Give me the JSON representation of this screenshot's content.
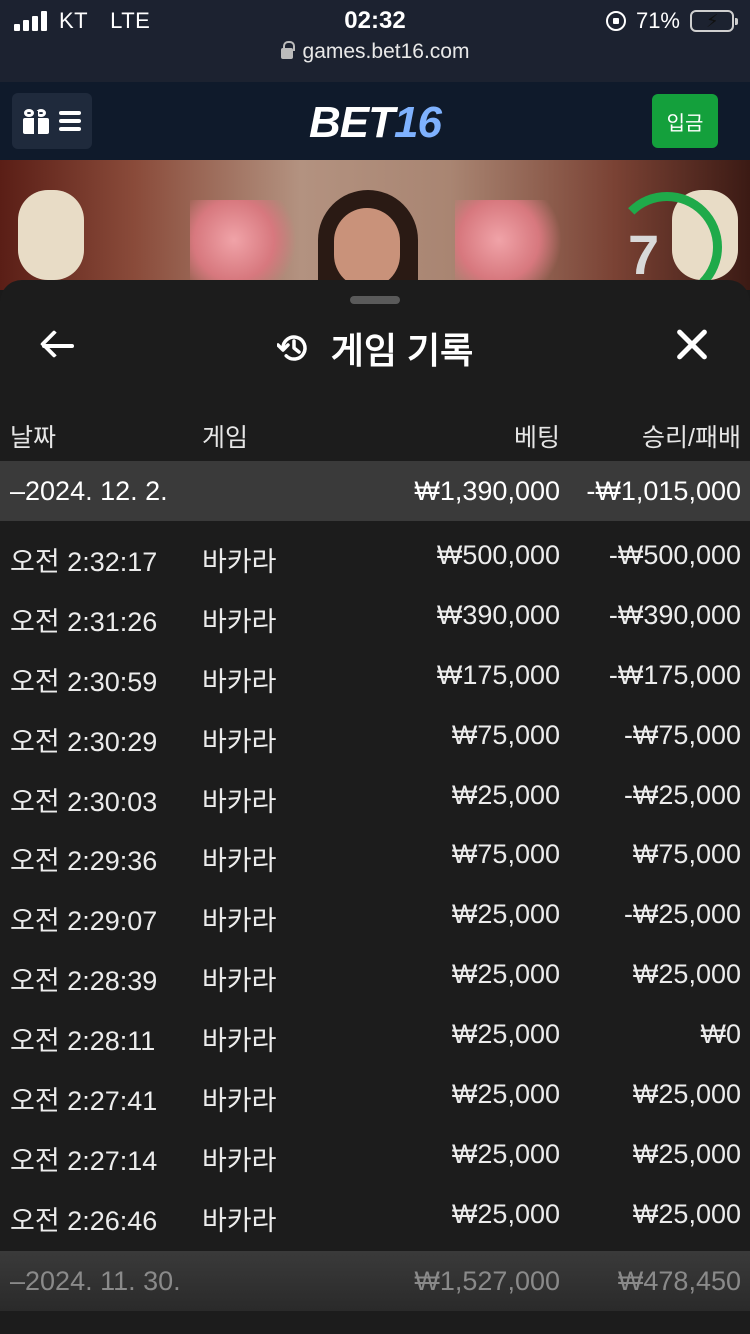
{
  "status_bar": {
    "carrier": "KT",
    "network": "LTE",
    "time": "02:32",
    "battery_percent": "71%",
    "battery_level": 0.71,
    "url": "games.bet16.com"
  },
  "header": {
    "logo_text": "BET",
    "logo_num": "16",
    "deposit_label": "입금"
  },
  "video": {
    "timer_value": "7"
  },
  "sheet": {
    "title": "게임 기록",
    "columns": {
      "date": "날짜",
      "game": "게임",
      "bet": "베팅",
      "result": "승리/패배"
    },
    "groups": [
      {
        "date": "–2024. 12. 2.",
        "bet": "₩1,390,000",
        "result": "-₩1,015,000"
      },
      {
        "date": "–2024. 11. 30.",
        "bet": "₩1,527,000",
        "result": "₩478,450"
      }
    ],
    "rows": [
      {
        "time": "오전 2:32:17",
        "game": "바카라",
        "bet": "₩500,000",
        "result": "-₩500,000"
      },
      {
        "time": "오전 2:31:26",
        "game": "바카라",
        "bet": "₩390,000",
        "result": "-₩390,000"
      },
      {
        "time": "오전 2:30:59",
        "game": "바카라",
        "bet": "₩175,000",
        "result": "-₩175,000"
      },
      {
        "time": "오전 2:30:29",
        "game": "바카라",
        "bet": "₩75,000",
        "result": "-₩75,000"
      },
      {
        "time": "오전 2:30:03",
        "game": "바카라",
        "bet": "₩25,000",
        "result": "-₩25,000"
      },
      {
        "time": "오전 2:29:36",
        "game": "바카라",
        "bet": "₩75,000",
        "result": "₩75,000"
      },
      {
        "time": "오전 2:29:07",
        "game": "바카라",
        "bet": "₩25,000",
        "result": "-₩25,000"
      },
      {
        "time": "오전 2:28:39",
        "game": "바카라",
        "bet": "₩25,000",
        "result": "₩25,000"
      },
      {
        "time": "오전 2:28:11",
        "game": "바카라",
        "bet": "₩25,000",
        "result": "₩0"
      },
      {
        "time": "오전 2:27:41",
        "game": "바카라",
        "bet": "₩25,000",
        "result": "₩25,000"
      },
      {
        "time": "오전 2:27:14",
        "game": "바카라",
        "bet": "₩25,000",
        "result": "₩25,000"
      },
      {
        "time": "오전 2:26:46",
        "game": "바카라",
        "bet": "₩25,000",
        "result": "₩25,000"
      }
    ]
  },
  "colors": {
    "accent_green": "#14a03c",
    "logo_blue": "#7fb2ff",
    "group_bg": "#3a3a3a"
  }
}
